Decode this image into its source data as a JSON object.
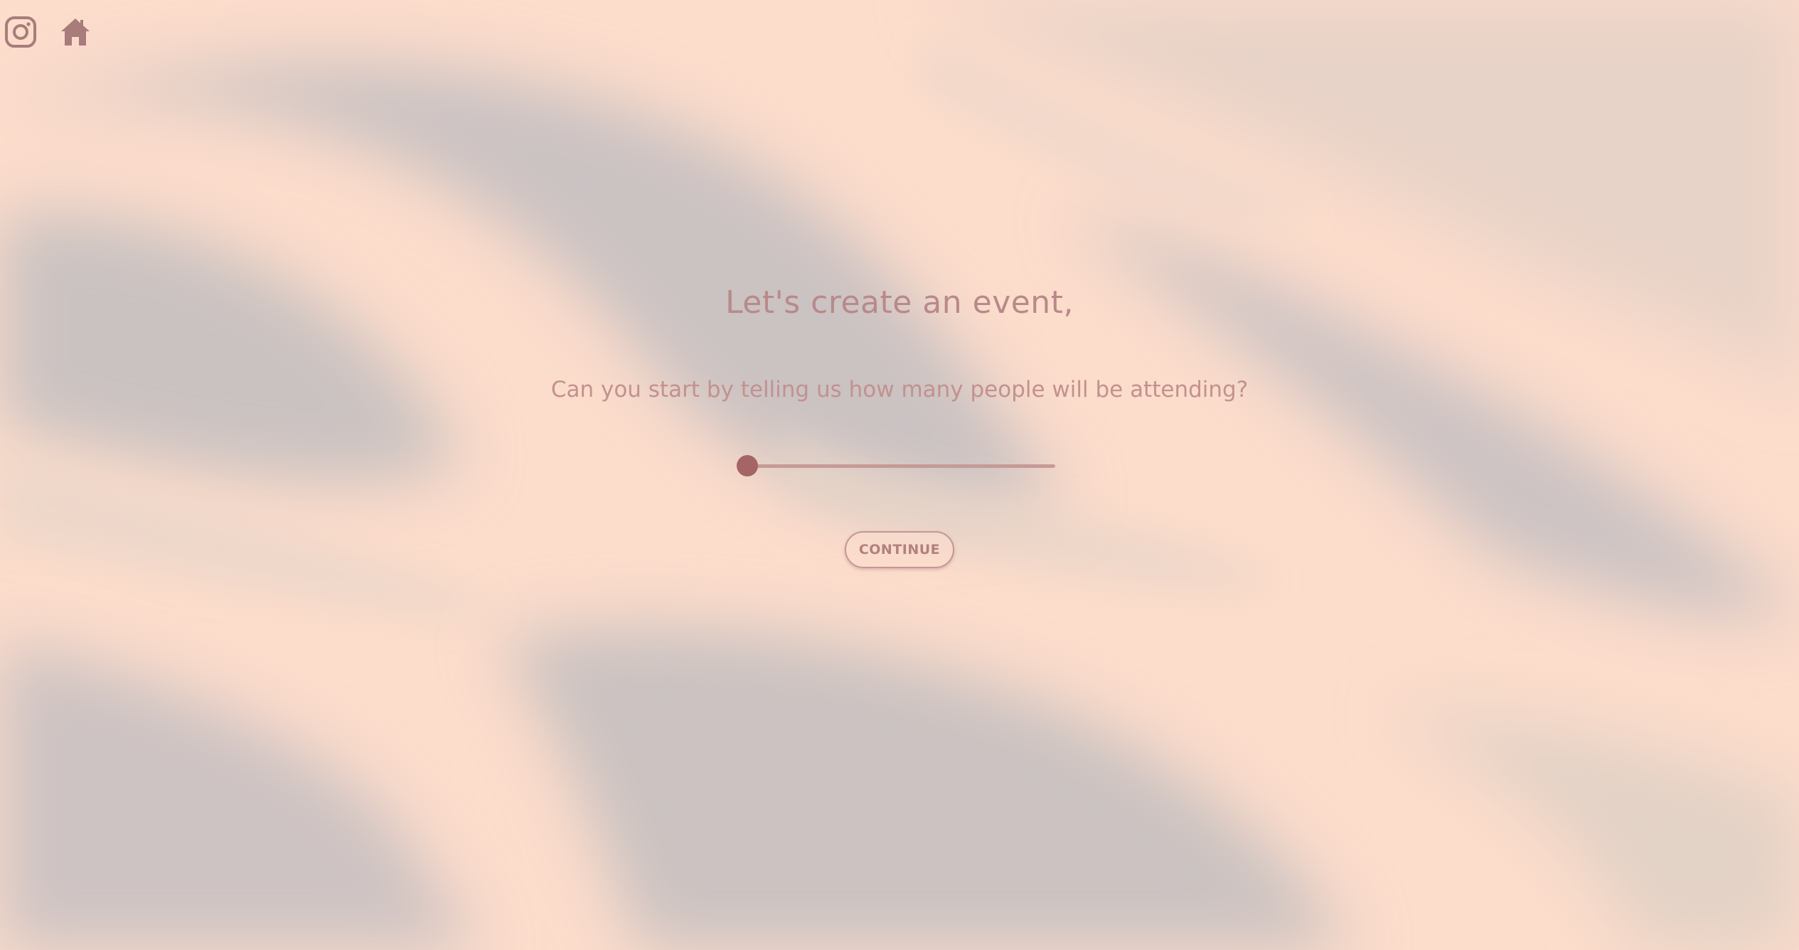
{
  "theme": {
    "background": "#fcdccb",
    "wave_dark": "#c9c1c0",
    "wave_mid": "#e6d6ca",
    "accent": "#a56465",
    "text": "#b9898a"
  },
  "nav": {
    "instagram_icon": "instagram-icon",
    "home_icon": "home-icon"
  },
  "main": {
    "title": "Let's create an event,",
    "question": "Can you start by telling us how many people will be attending?",
    "attendees_slider": {
      "value_fraction": 0.0
    },
    "continue_label": "CONTINUE"
  }
}
